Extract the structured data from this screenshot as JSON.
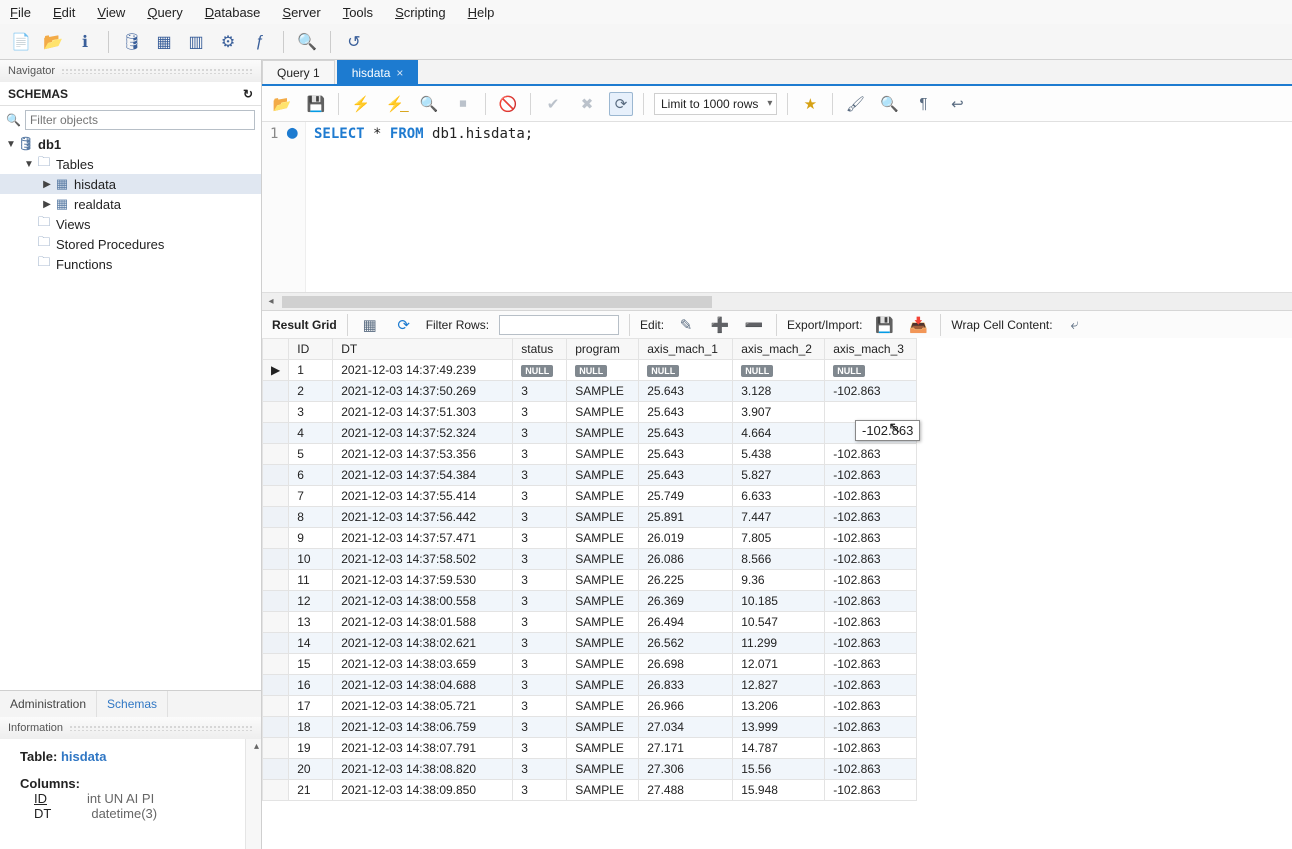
{
  "menu": [
    "File",
    "Edit",
    "View",
    "Query",
    "Database",
    "Server",
    "Tools",
    "Scripting",
    "Help"
  ],
  "navigator": {
    "title": "Navigator"
  },
  "schemas": {
    "title": "SCHEMAS",
    "refresh_icon": "↻"
  },
  "filter": {
    "placeholder": "Filter objects",
    "search_icon": "🔍"
  },
  "tree": {
    "db": "db1",
    "tables_label": "Tables",
    "table1": "hisdata",
    "table2": "realdata",
    "views": "Views",
    "sp": "Stored Procedures",
    "fn": "Functions"
  },
  "side_tabs": {
    "admin": "Administration",
    "schemas": "Schemas"
  },
  "info": {
    "title": "Information",
    "table_lbl": "Table:",
    "table_name": "hisdata",
    "columns_lbl": "Columns:",
    "col1_name": "ID",
    "col1_type": "int UN AI PI",
    "col2_name": "DT",
    "col2_type": "datetime(3)"
  },
  "doc_tabs": {
    "q1": "Query 1",
    "t2": "hisdata"
  },
  "ed_toolbar": {
    "limit": "Limit to 1000 rows"
  },
  "sql": {
    "line": "1",
    "select": "SELECT",
    "star": "*",
    "from": "FROM",
    "rest": " db1.hisdata;"
  },
  "res_toolbar": {
    "label": "Result Grid",
    "filter": "Filter Rows:",
    "edit": "Edit:",
    "export": "Export/Import:",
    "wrap": "Wrap Cell Content:"
  },
  "columns": [
    "ID",
    "DT",
    "status",
    "program",
    "axis_mach_1",
    "axis_mach_2",
    "axis_mach_3"
  ],
  "null_label": "NULL",
  "inline_edit_value": "-102.863",
  "rows": [
    {
      "id": "1",
      "dt": "2021-12-03 14:37:49.239",
      "status": "NULL",
      "program": "NULL",
      "a1": "NULL",
      "a2": "NULL",
      "a3": "NULL"
    },
    {
      "id": "2",
      "dt": "2021-12-03 14:37:50.269",
      "status": "3",
      "program": "SAMPLE",
      "a1": "25.643",
      "a2": "3.128",
      "a3": "-102.863"
    },
    {
      "id": "3",
      "dt": "2021-12-03 14:37:51.303",
      "status": "3",
      "program": "SAMPLE",
      "a1": "25.643",
      "a2": "3.907",
      "a3": ""
    },
    {
      "id": "4",
      "dt": "2021-12-03 14:37:52.324",
      "status": "3",
      "program": "SAMPLE",
      "a1": "25.643",
      "a2": "4.664",
      "a3": ""
    },
    {
      "id": "5",
      "dt": "2021-12-03 14:37:53.356",
      "status": "3",
      "program": "SAMPLE",
      "a1": "25.643",
      "a2": "5.438",
      "a3": "-102.863"
    },
    {
      "id": "6",
      "dt": "2021-12-03 14:37:54.384",
      "status": "3",
      "program": "SAMPLE",
      "a1": "25.643",
      "a2": "5.827",
      "a3": "-102.863"
    },
    {
      "id": "7",
      "dt": "2021-12-03 14:37:55.414",
      "status": "3",
      "program": "SAMPLE",
      "a1": "25.749",
      "a2": "6.633",
      "a3": "-102.863"
    },
    {
      "id": "8",
      "dt": "2021-12-03 14:37:56.442",
      "status": "3",
      "program": "SAMPLE",
      "a1": "25.891",
      "a2": "7.447",
      "a3": "-102.863"
    },
    {
      "id": "9",
      "dt": "2021-12-03 14:37:57.471",
      "status": "3",
      "program": "SAMPLE",
      "a1": "26.019",
      "a2": "7.805",
      "a3": "-102.863"
    },
    {
      "id": "10",
      "dt": "2021-12-03 14:37:58.502",
      "status": "3",
      "program": "SAMPLE",
      "a1": "26.086",
      "a2": "8.566",
      "a3": "-102.863"
    },
    {
      "id": "11",
      "dt": "2021-12-03 14:37:59.530",
      "status": "3",
      "program": "SAMPLE",
      "a1": "26.225",
      "a2": "9.36",
      "a3": "-102.863"
    },
    {
      "id": "12",
      "dt": "2021-12-03 14:38:00.558",
      "status": "3",
      "program": "SAMPLE",
      "a1": "26.369",
      "a2": "10.185",
      "a3": "-102.863"
    },
    {
      "id": "13",
      "dt": "2021-12-03 14:38:01.588",
      "status": "3",
      "program": "SAMPLE",
      "a1": "26.494",
      "a2": "10.547",
      "a3": "-102.863"
    },
    {
      "id": "14",
      "dt": "2021-12-03 14:38:02.621",
      "status": "3",
      "program": "SAMPLE",
      "a1": "26.562",
      "a2": "11.299",
      "a3": "-102.863"
    },
    {
      "id": "15",
      "dt": "2021-12-03 14:38:03.659",
      "status": "3",
      "program": "SAMPLE",
      "a1": "26.698",
      "a2": "12.071",
      "a3": "-102.863"
    },
    {
      "id": "16",
      "dt": "2021-12-03 14:38:04.688",
      "status": "3",
      "program": "SAMPLE",
      "a1": "26.833",
      "a2": "12.827",
      "a3": "-102.863"
    },
    {
      "id": "17",
      "dt": "2021-12-03 14:38:05.721",
      "status": "3",
      "program": "SAMPLE",
      "a1": "26.966",
      "a2": "13.206",
      "a3": "-102.863"
    },
    {
      "id": "18",
      "dt": "2021-12-03 14:38:06.759",
      "status": "3",
      "program": "SAMPLE",
      "a1": "27.034",
      "a2": "13.999",
      "a3": "-102.863"
    },
    {
      "id": "19",
      "dt": "2021-12-03 14:38:07.791",
      "status": "3",
      "program": "SAMPLE",
      "a1": "27.171",
      "a2": "14.787",
      "a3": "-102.863"
    },
    {
      "id": "20",
      "dt": "2021-12-03 14:38:08.820",
      "status": "3",
      "program": "SAMPLE",
      "a1": "27.306",
      "a2": "15.56",
      "a3": "-102.863"
    },
    {
      "id": "21",
      "dt": "2021-12-03 14:38:09.850",
      "status": "3",
      "program": "SAMPLE",
      "a1": "27.488",
      "a2": "15.948",
      "a3": "-102.863"
    }
  ]
}
